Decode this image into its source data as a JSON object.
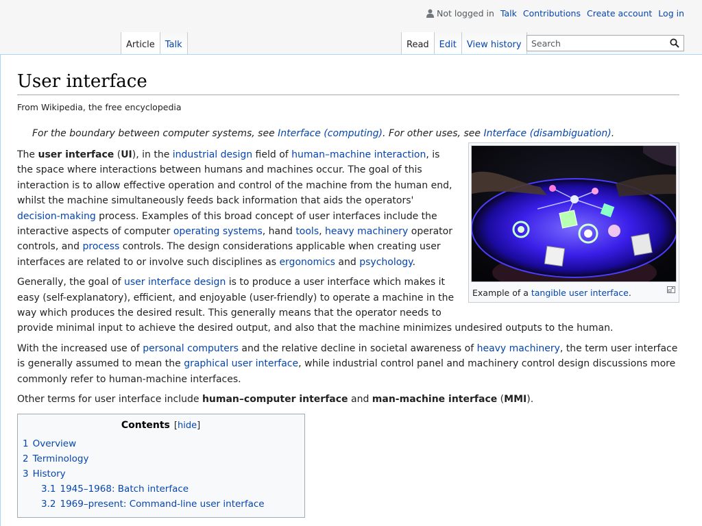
{
  "personal": {
    "not_logged_in": "Not logged in",
    "talk": "Talk",
    "contributions": "Contributions",
    "create_account": "Create account",
    "log_in": "Log in"
  },
  "tabs": {
    "article": "Article",
    "talk": "Talk",
    "read": "Read",
    "edit": "Edit",
    "view_history": "View history"
  },
  "search": {
    "placeholder": "Search"
  },
  "page": {
    "title": "User interface",
    "sitesub": "From Wikipedia, the free encyclopedia",
    "hatnote": {
      "t1": "For the boundary between computer systems, see ",
      "l1": "Interface (computing)",
      "t2": ". For other uses, see ",
      "l2": "Interface (disambiguation)",
      "t3": "."
    }
  },
  "thumb": {
    "caption_text": "Example of a ",
    "caption_link": "tangible user interface",
    "caption_end": "."
  },
  "para1": {
    "t1": "The ",
    "b1": "user interface",
    "t2": " (",
    "b2": "UI",
    "t3": "), in the ",
    "l1": "industrial design",
    "t4": " field of ",
    "l2": "human–machine interaction",
    "t5": ", is the space where interactions between humans and machines occur. The goal of this interaction is to allow effective operation and control of the machine from the human end, whilst the machine simultaneously feeds back information that aids the operators' ",
    "l3": "decision-making",
    "t6": " process. Examples of this broad concept of user interfaces include the interactive aspects of computer ",
    "l4": "operating systems",
    "t7": ", hand ",
    "l5": "tools",
    "t8": ", ",
    "l6": "heavy machinery",
    "t9": " operator controls, and ",
    "l7": "process",
    "t10": " controls. The design considerations applicable when creating user interfaces are related to or involve such disciplines as ",
    "l8": "ergonomics",
    "t11": " and ",
    "l9": "psychology",
    "t12": "."
  },
  "para2": {
    "t1": "Generally, the goal of ",
    "l1": "user interface design",
    "t2": " is to produce a user interface which makes it easy (self-explanatory), efficient, and enjoyable (user-friendly) to operate a machine in the way which produces the desired result. This generally means that the operator needs to provide minimal input to achieve the desired output, and also that the machine minimizes undesired outputs to the human."
  },
  "para3": {
    "t1": "With the increased use of ",
    "l1": "personal computers",
    "t2": " and the relative decline in societal awareness of ",
    "l2": "heavy machinery",
    "t3": ", the term user interface is generally assumed to mean the ",
    "l3": "graphical user interface",
    "t4": ", while industrial control panel and machinery control design discussions more commonly refer to human-machine interfaces."
  },
  "para4": {
    "t1": "Other terms for user interface include ",
    "b1": "human–computer interface",
    "t2": " and ",
    "b2": "man-machine interface",
    "t3": " (",
    "b3": "MMI",
    "t4": ")."
  },
  "toc": {
    "title": "Contents",
    "toggle_open": "[",
    "toggle_label": "hide",
    "toggle_close": "]",
    "items": [
      {
        "num": "1",
        "label": "Overview"
      },
      {
        "num": "2",
        "label": "Terminology"
      },
      {
        "num": "3",
        "label": "History"
      },
      {
        "num": "3.1",
        "label": "1945–1968: Batch interface"
      },
      {
        "num": "3.2",
        "label": "1969–present: Command-line user interface"
      }
    ]
  }
}
